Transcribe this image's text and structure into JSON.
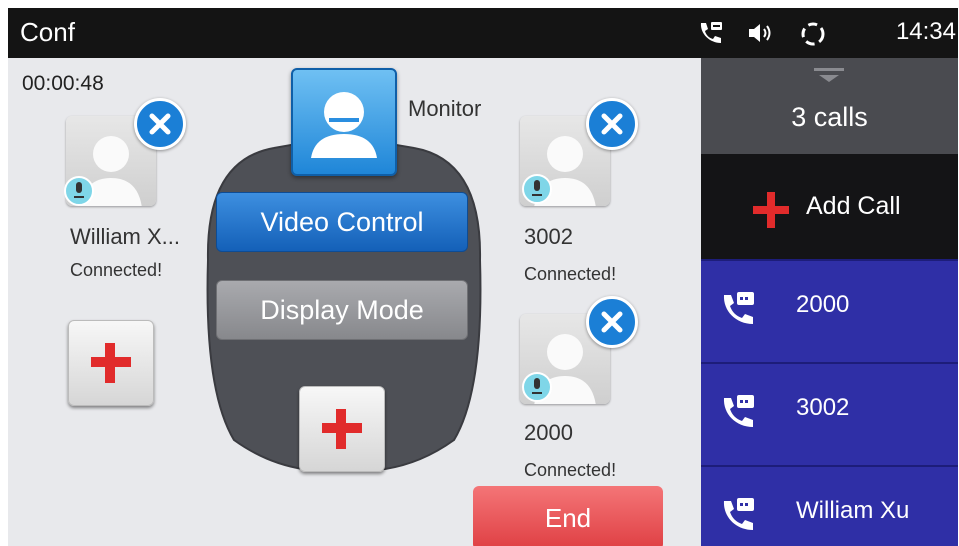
{
  "statusbar": {
    "title": "Conf",
    "time": "14:34",
    "icons": [
      "call-forward-icon",
      "volume-icon",
      "sync-icon"
    ]
  },
  "conference": {
    "timer": "00:00:48",
    "monitor_label": "Monitor",
    "participants": [
      {
        "name": "William X...",
        "status": "Connected!"
      },
      {
        "name": "3002",
        "status": "Connected!"
      },
      {
        "name": "2000",
        "status": "Connected!"
      }
    ]
  },
  "popup_menu": {
    "items": [
      "Video Control",
      "Display Mode"
    ]
  },
  "end_label": "End",
  "sidebar": {
    "calls_count": "3 calls",
    "add_call_label": "Add Call",
    "calls": [
      "2000",
      "3002",
      "William Xu"
    ]
  },
  "colors": {
    "accent_blue": "#1b7fd6",
    "end_red": "#e24a4e",
    "call_list_bg": "#2f2fa6",
    "add_red": "#e12b2b"
  }
}
